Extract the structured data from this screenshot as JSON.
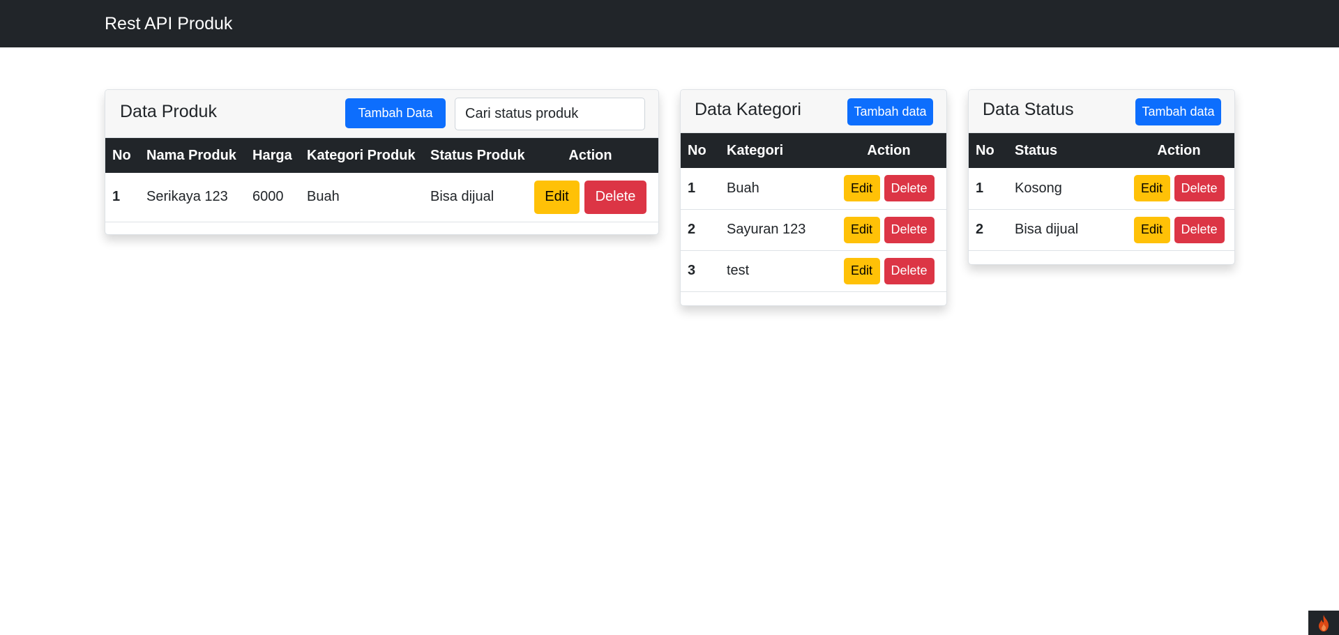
{
  "navbar": {
    "brand": "Rest API Produk"
  },
  "produk": {
    "title": "Data Produk",
    "add_label": "Tambah Data",
    "search_placeholder": "Cari status produk",
    "columns": [
      "No",
      "Nama Produk",
      "Harga",
      "Kategori Produk",
      "Status Produk",
      "Action"
    ],
    "rows": [
      {
        "no": "1",
        "nama": "Serikaya 123",
        "harga": "6000",
        "kategori": "Buah",
        "status": "Bisa dijual"
      }
    ],
    "edit_label": "Edit",
    "delete_label": "Delete"
  },
  "kategori": {
    "title": "Data Kategori",
    "add_label": "Tambah data",
    "columns": [
      "No",
      "Kategori",
      "Action"
    ],
    "rows": [
      {
        "no": "1",
        "name": "Buah"
      },
      {
        "no": "2",
        "name": "Sayuran 123"
      },
      {
        "no": "3",
        "name": "test"
      }
    ],
    "edit_label": "Edit",
    "delete_label": "Delete"
  },
  "status": {
    "title": "Data Status",
    "add_label": "Tambah data",
    "columns": [
      "No",
      "Status",
      "Action"
    ],
    "rows": [
      {
        "no": "1",
        "name": "Kosong"
      },
      {
        "no": "2",
        "name": "Bisa dijual"
      }
    ],
    "edit_label": "Edit",
    "delete_label": "Delete"
  },
  "colors": {
    "navbar": "#212529",
    "primary": "#0d6efd",
    "warning": "#ffc107",
    "danger": "#dc3545"
  },
  "icons": {
    "corner": "flame-icon"
  }
}
